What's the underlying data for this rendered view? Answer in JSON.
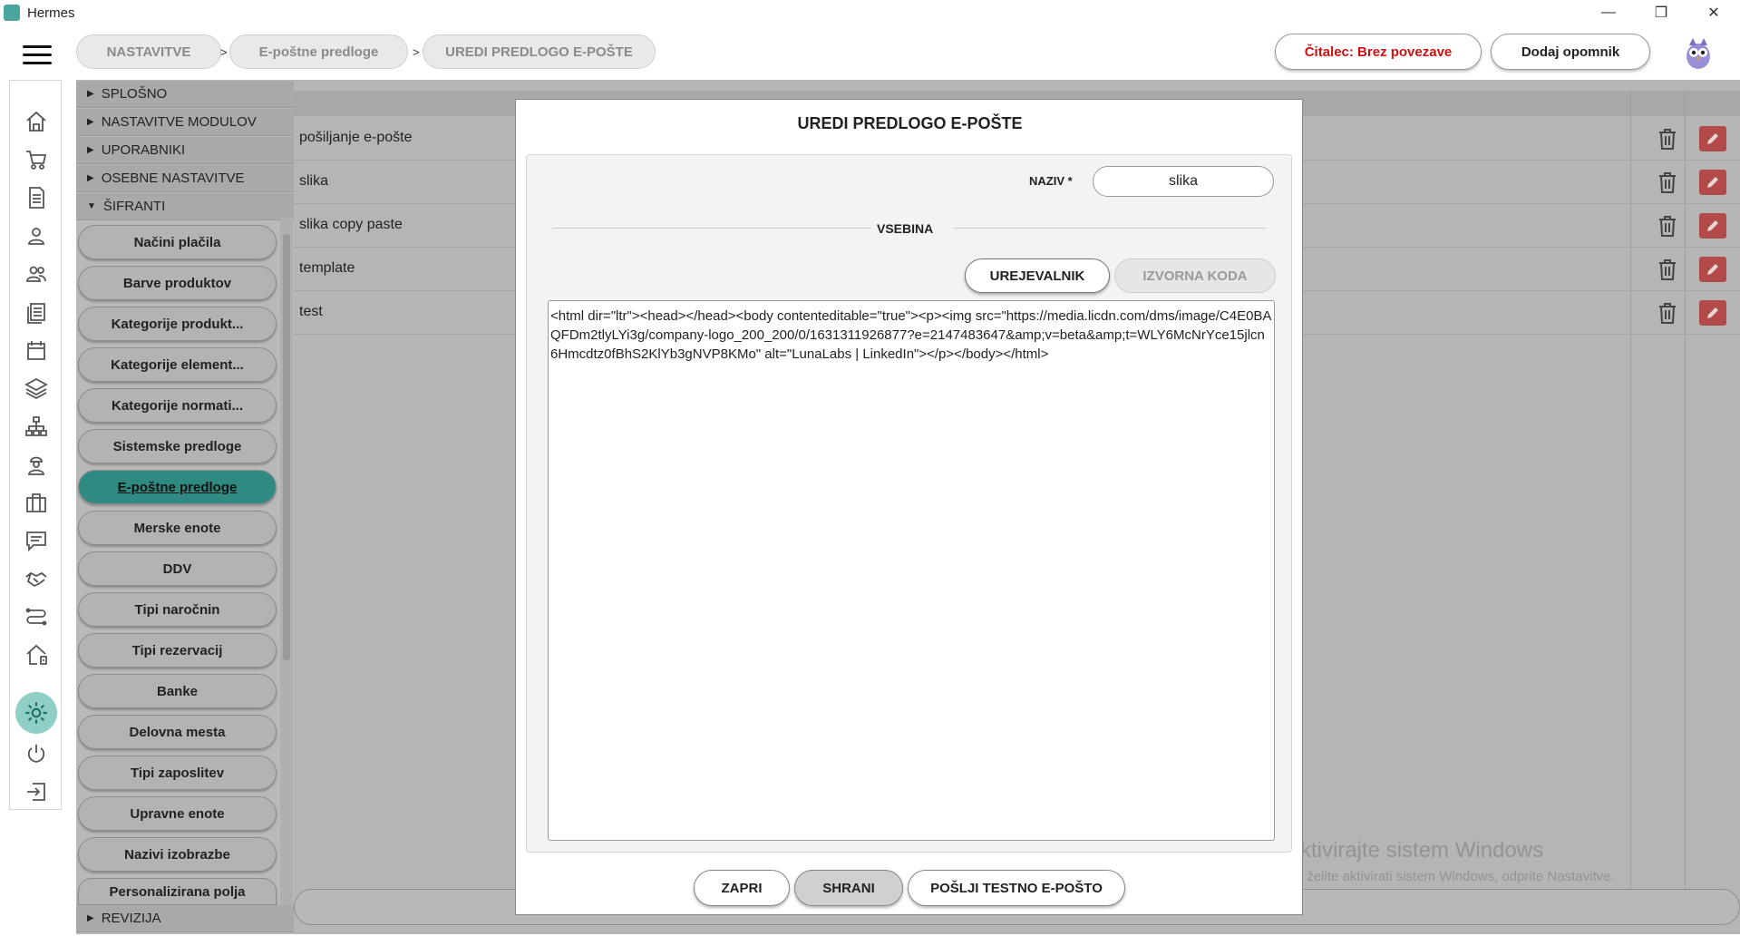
{
  "window": {
    "title": "Hermes",
    "minimize": "—",
    "maximize": "❐",
    "close": "✕"
  },
  "breadcrumb": [
    "NASTAVITVE",
    "E-poštne predloge",
    "UREDI PREDLOGO E-POŠTE"
  ],
  "breadcrumb_sep": ">",
  "header": {
    "reader_status": "Čitalec: Brez povezave",
    "add_reminder": "Dodaj opomnik"
  },
  "sidebar": {
    "sections": [
      "SPLOŠNO",
      "NASTAVITVE MODULOV",
      "UPORABNIKI",
      "OSEBNE NASTAVITVE",
      "ŠIFRANTI"
    ],
    "items": [
      "Načini plačila",
      "Barve produktov",
      "Kategorije produkt...",
      "Kategorije element...",
      "Kategorije normati...",
      "Sistemske predloge",
      "E-poštne predloge",
      "Merske enote",
      "DDV",
      "Tipi naročnin",
      "Tipi rezervacij",
      "Banke",
      "Delovna mesta",
      "Tipi zaposlitev",
      "Upravne enote",
      "Nazivi izobrazbe",
      "Personalizirana polja"
    ],
    "active_item": "E-poštne predloge",
    "footer_section": "REVIZIJA"
  },
  "table": {
    "rows": [
      "pošiljanje e-pošte",
      "slika",
      "slika copy paste",
      "template",
      "test"
    ]
  },
  "modal": {
    "title": "UREDI PREDLOGO E-POŠTE",
    "name_label": "NAZIV *",
    "name_value": "slika",
    "content_label": "VSEBINA",
    "tab_editor": "UREJEVALNIK",
    "tab_source": "IZVORNA KODA",
    "source_code": "<html dir=\"ltr\"><head></head><body contenteditable=\"true\"><p><img src=\"https://media.licdn.com/dms/image/C4E0BAQFDm2tlyLYi3g/company-logo_200_200/0/1631311926877?e=2147483647&amp;v=beta&amp;t=WLY6McNrYce15jlcn6Hmcdtz0fBhS2KlYb3gNVP8KMo\" alt=\"LunaLabs | LinkedIn\"></p></body></html>",
    "btn_close": "ZAPRI",
    "btn_save": "SHRANI",
    "btn_test": "POŠLJI TESTNO E-POŠTO"
  },
  "watermark": {
    "line1": "Aktivirajte sistem Windows",
    "line2": "Če želite aktivirati sistem Windows, odprite Nastavitve."
  },
  "colors": {
    "accent": "#2f8b82",
    "danger": "#cc1111",
    "edit": "#b34a4a"
  }
}
